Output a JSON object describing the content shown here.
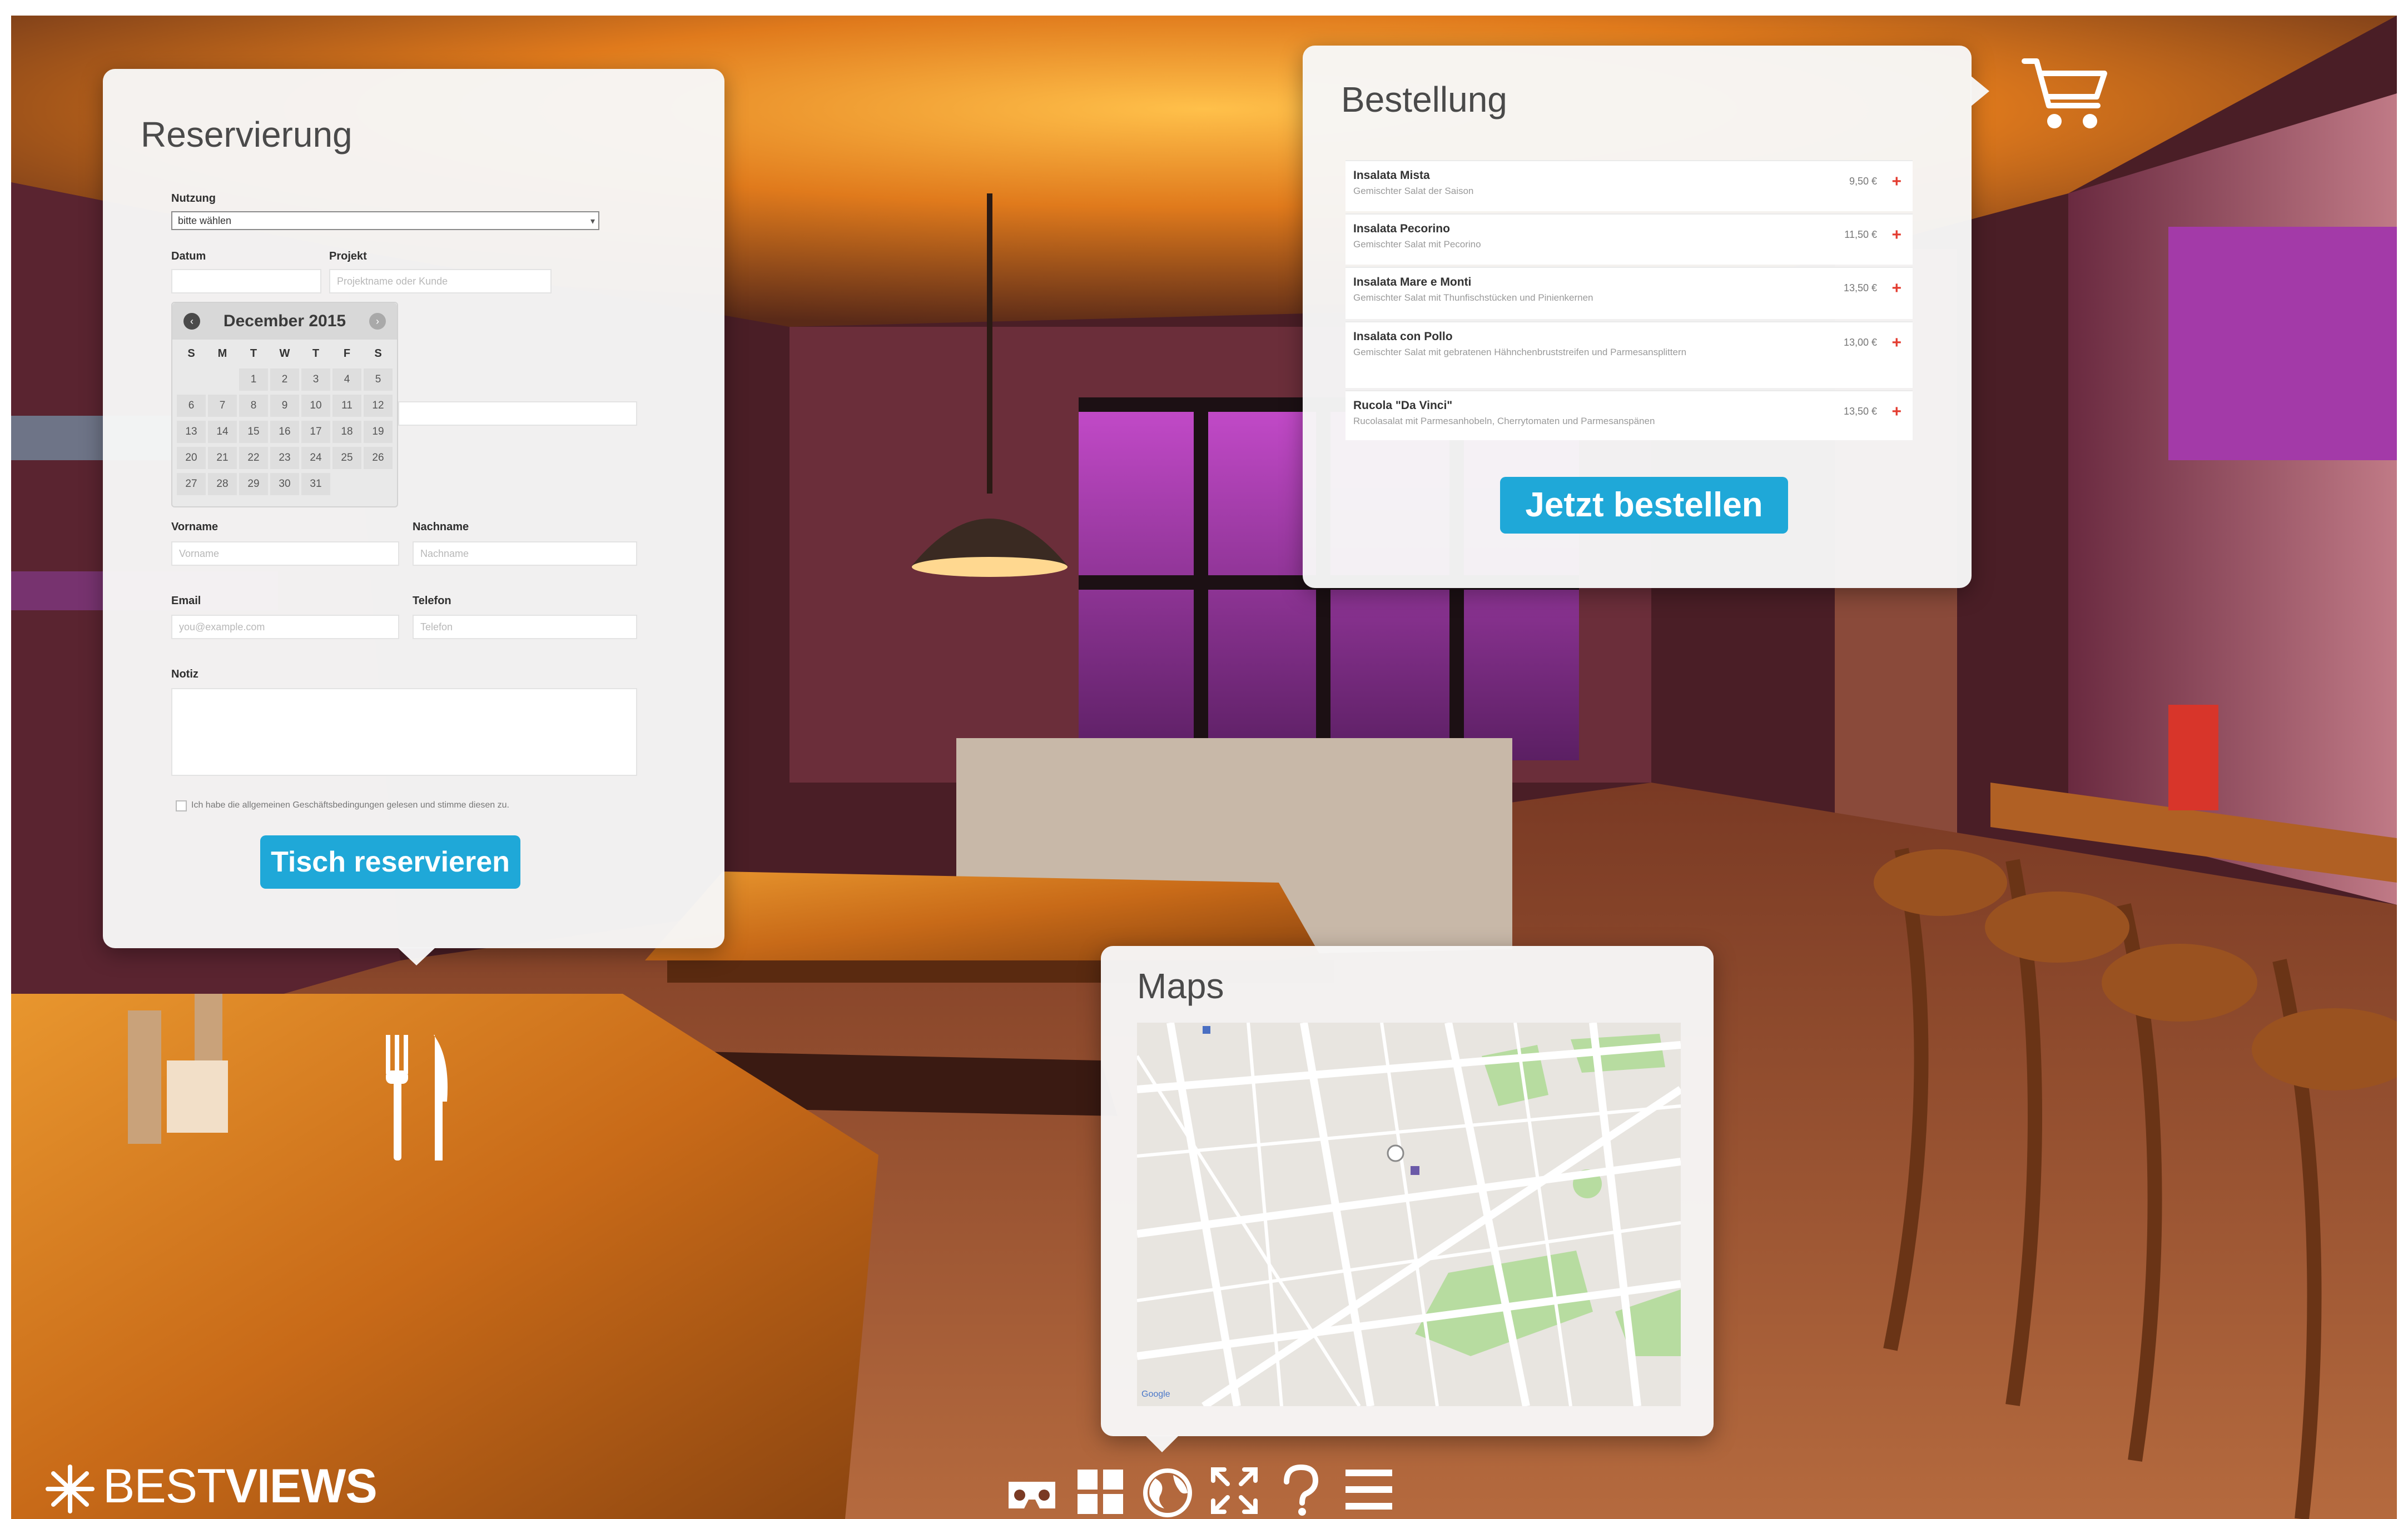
{
  "reservation": {
    "title": "Reservierung",
    "usage_label": "Nutzung",
    "usage_value": "bitte wählen",
    "date_label": "Datum",
    "project_label": "Projekt",
    "project_placeholder": "Projektname oder Kunde",
    "calendar": {
      "month_title": "December 2015",
      "weekdays": [
        "S",
        "M",
        "T",
        "W",
        "T",
        "F",
        "S"
      ],
      "weeks": [
        [
          "",
          "",
          "1",
          "2",
          "3",
          "4",
          "5"
        ],
        [
          "6",
          "7",
          "8",
          "9",
          "10",
          "11",
          "12"
        ],
        [
          "13",
          "14",
          "15",
          "16",
          "17",
          "18",
          "19"
        ],
        [
          "20",
          "21",
          "22",
          "23",
          "24",
          "25",
          "26"
        ],
        [
          "27",
          "28",
          "29",
          "30",
          "31",
          "",
          ""
        ]
      ]
    },
    "firstname_label": "Vorname",
    "firstname_placeholder": "Vorname",
    "lastname_label": "Nachname",
    "lastname_placeholder": "Nachname",
    "email_label": "Email",
    "email_placeholder": "you@example.com",
    "phone_label": "Telefon",
    "phone_placeholder": "Telefon",
    "notes_label": "Notiz",
    "terms_text": "Ich habe die allgemeinen Geschäftsbedingungen gelesen und stimme diesen zu.",
    "submit_label": "Tisch reservieren"
  },
  "order": {
    "title": "Bestellung",
    "items": [
      {
        "name": "Insalata Mista",
        "desc": "Gemischter Salat der Saison",
        "price": "9,50 €"
      },
      {
        "name": "Insalata Pecorino",
        "desc": "Gemischter Salat mit Pecorino",
        "price": "11,50 €"
      },
      {
        "name": "Insalata Mare e Monti",
        "desc": "Gemischter Salat mit Thunfischstücken und Pinienkernen",
        "price": "13,50 €"
      },
      {
        "name": "Insalata con Pollo",
        "desc": "Gemischter Salat mit gebratenen Hähnchenbruststreifen und Parmesansplittern",
        "price": "13,00 €"
      },
      {
        "name": "Rucola \"Da Vinci\"",
        "desc": "Rucolasalat mit Parmesanhobeln, Cherrytomaten und Parmesanspänen",
        "price": "13,50 €"
      }
    ],
    "submit_label": "Jetzt bestellen"
  },
  "maps": {
    "title": "Maps",
    "labels": [
      "Google"
    ]
  },
  "brand": {
    "light": "BEST",
    "bold": "VIEWS"
  },
  "toolbar": {
    "icons": [
      "vr-glasses-icon",
      "thumbnails-icon",
      "globe-icon",
      "fullscreen-icon",
      "help-icon",
      "menu-icon"
    ]
  },
  "colors": {
    "accent": "#1fa8d8",
    "add": "#e33b2f",
    "panel": "#f7f7f7"
  }
}
